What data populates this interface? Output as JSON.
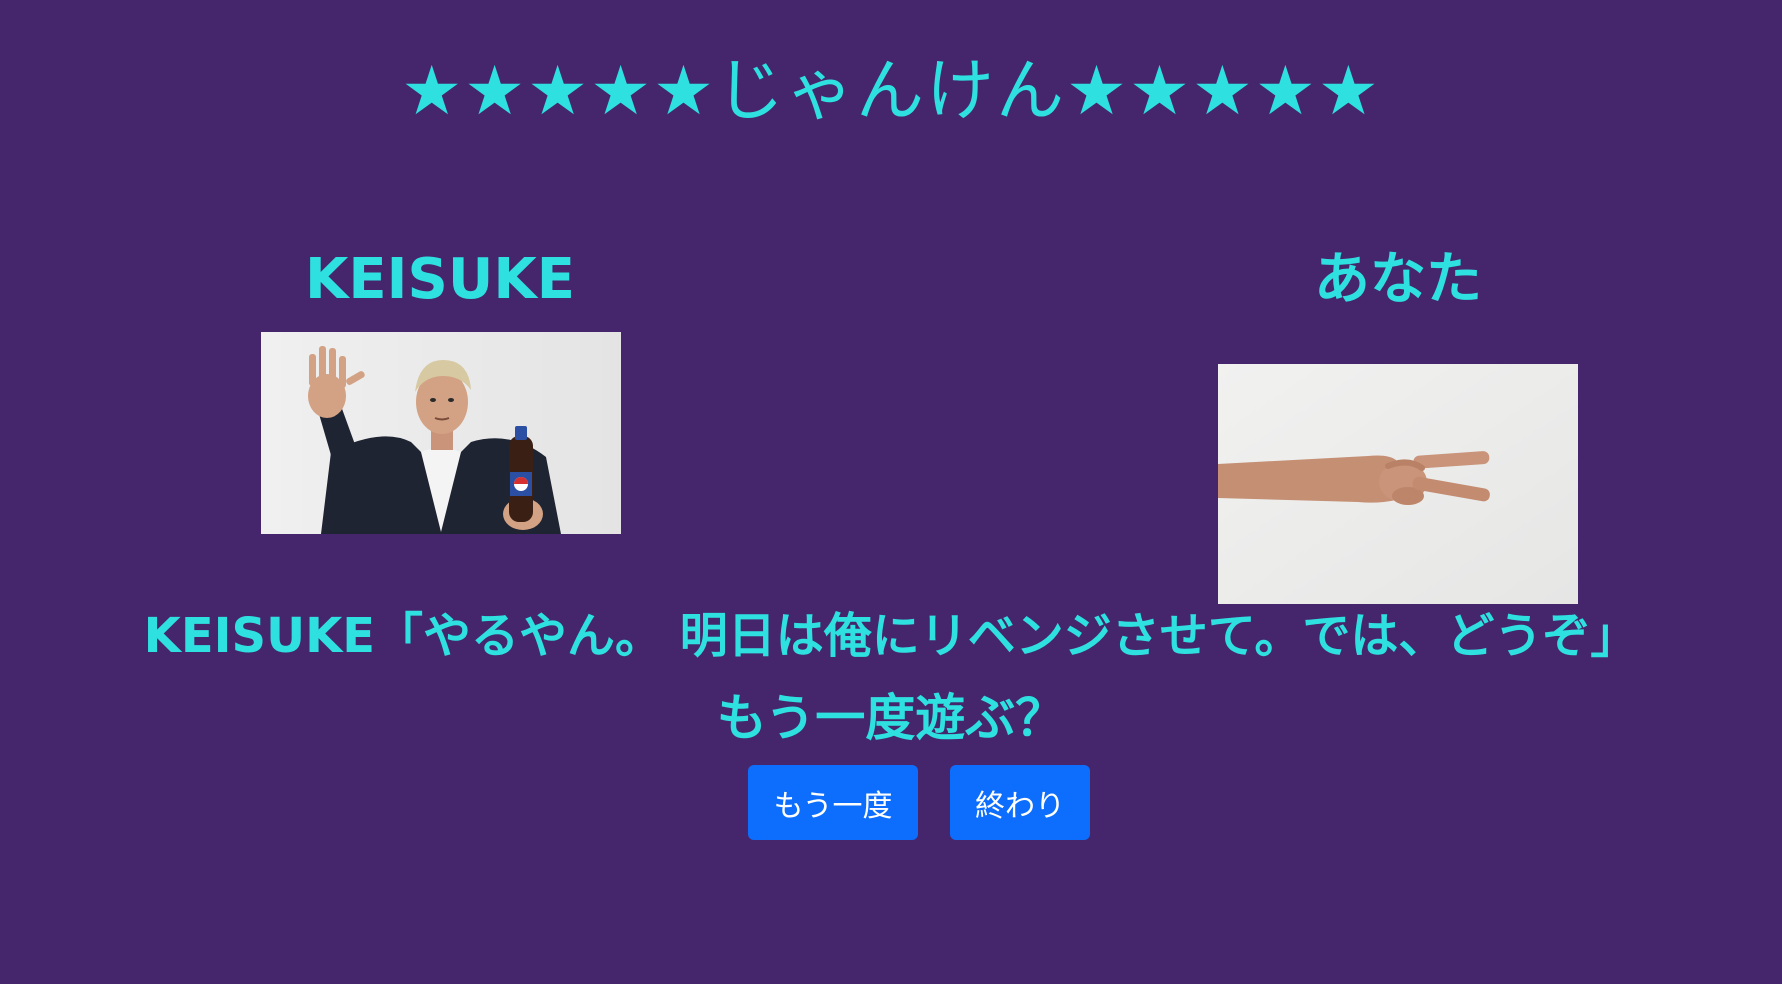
{
  "title": "★★★★★じゃんけん★★★★★",
  "opponent": {
    "name": "KEISUKE",
    "image_alt": "KEISUKE パー"
  },
  "player": {
    "name": "あなた",
    "image_alt": "チョキ"
  },
  "result_message": "KEISUKE「やるやん。 明日は俺にリベンジさせて。では、どうぞ」",
  "prompt": "もう一度遊ぶ？",
  "buttons": {
    "again_label": "もう一度",
    "end_label": "終わり"
  },
  "colors": {
    "background": "#45266d",
    "text_accent": "#2ee0df",
    "button": "#0d6efd"
  }
}
